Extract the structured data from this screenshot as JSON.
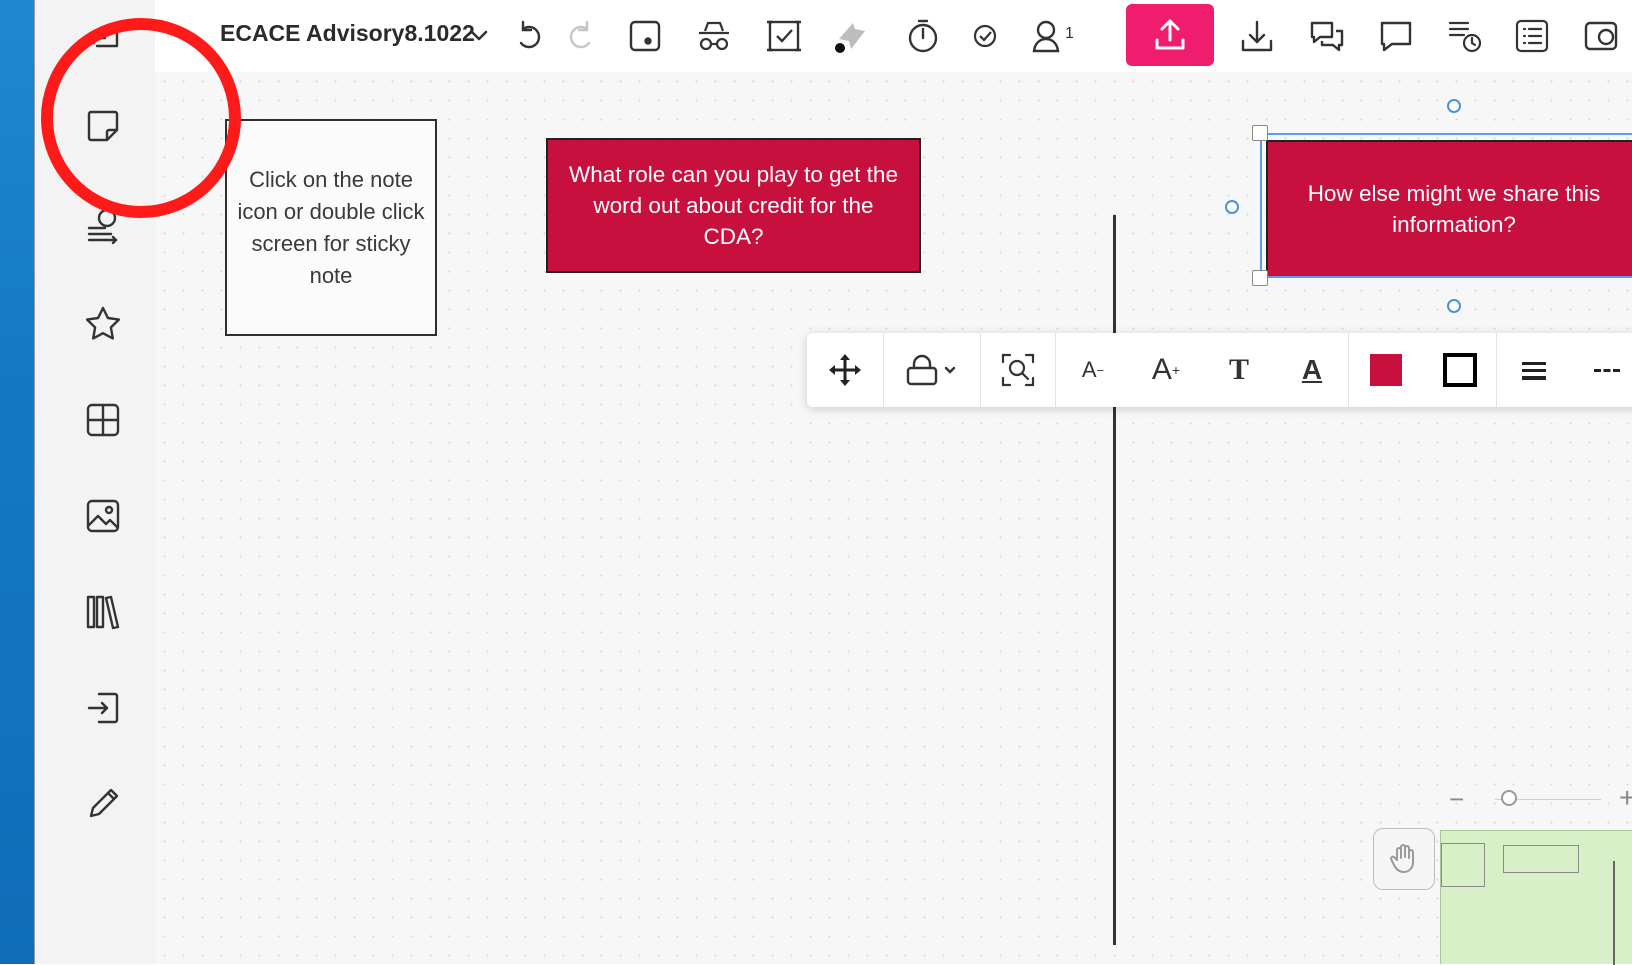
{
  "board": {
    "title": "ECACE Advisory8.1022",
    "collaborators_count": "1"
  },
  "sidebar": {
    "items": [
      {
        "name": "exit"
      },
      {
        "name": "sticky-note"
      },
      {
        "name": "shapes"
      },
      {
        "name": "favorites"
      },
      {
        "name": "templates"
      },
      {
        "name": "image"
      },
      {
        "name": "library"
      },
      {
        "name": "import"
      },
      {
        "name": "pen"
      }
    ]
  },
  "canvas": {
    "hint_note": "Click on the  note icon or double click screen for sticky note",
    "card1": "What role can you play to get the word out about credit for the CDA?",
    "card2": "How else might we share this information?",
    "card_color": "#c8103e"
  },
  "context_toolbar": {
    "font_decrease": "A",
    "font_increase": "A",
    "text_style": "T",
    "text_color": "A",
    "fill_color": "#c8103e",
    "border_color": "#000000"
  },
  "zoom": {
    "minus": "−",
    "plus": "+"
  },
  "colors": {
    "accent": "#f01d6f",
    "annotation": "#ff1a1a",
    "selection": "#5b9bf2"
  }
}
